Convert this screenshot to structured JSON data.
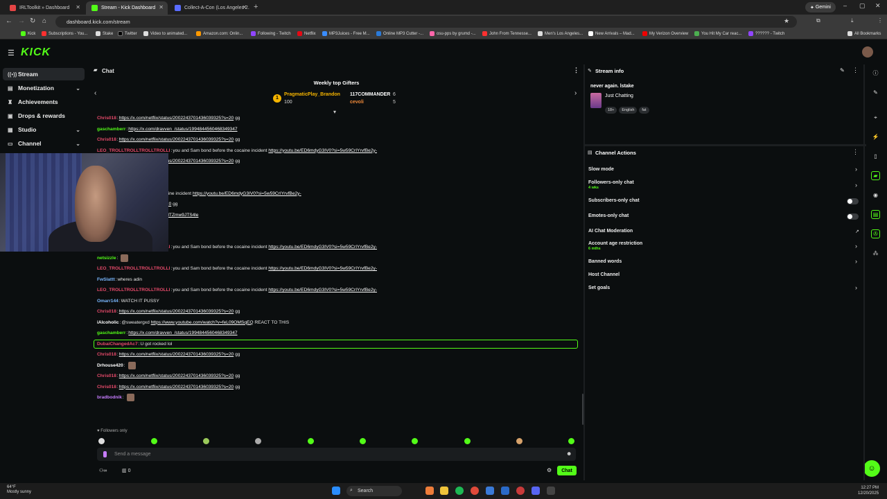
{
  "browser": {
    "tabs": [
      {
        "label": "IRLToolkit » Dashboard",
        "color": "#e54545"
      },
      {
        "label": "Stream - Kick Dashboard",
        "color": "#53fc18"
      },
      {
        "label": "Collect-A-Con (Los Angeles 2.",
        "color": "#5a6cff"
      }
    ],
    "gemini": "Gemini",
    "url": "dashboard.kick.com/stream",
    "bookmarks": [
      "Kick",
      "Subscriptions - You...",
      "Stake",
      "Twitter",
      "Video to animated...",
      "Amazon.com: Onlin...",
      "Following - Twitch",
      "Netflix",
      "MP3Juices - Free M...",
      "Online MP3 Cutter -...",
      "osu-pps by grumd -...",
      "John From Tennesse...",
      "Men's Los Angeles...",
      "New Arrivals – Mad...",
      "My Verizon Overview",
      "You Hit My Car reac...",
      "?????? - Twitch"
    ],
    "all_bookmarks": "All Bookmarks"
  },
  "sidebar": {
    "items": [
      {
        "label": "Stream",
        "icon": "broadcast-icon"
      },
      {
        "label": "Monetization",
        "icon": "money-icon"
      },
      {
        "label": "Achievements",
        "icon": "trophy-icon"
      },
      {
        "label": "Drops & rewards",
        "icon": "gift-icon"
      },
      {
        "label": "Studio",
        "icon": "studio-icon"
      },
      {
        "label": "Channel",
        "icon": "channel-icon"
      }
    ]
  },
  "chat": {
    "title": "Chat",
    "gifters_title": "Weekly top Gifters",
    "gifters": [
      {
        "name": "PragmaticPlay_Brandon",
        "count": "100"
      },
      {
        "name": "117COMMANDER",
        "count": "6"
      },
      {
        "name": "cevoli",
        "count": "5"
      }
    ],
    "messages": [
      {
        "user": "Chris018",
        "color": "#e64a6a",
        "text": "https://x.com/netflix/status/2002243701436039325?s=20 gg"
      },
      {
        "user": "gaschamberr",
        "color": "#53fc18",
        "text": "https://x.com/dravven_/status/1994844560468349347"
      },
      {
        "user": "Chris018",
        "color": "#e64a6a",
        "text": "https://x.com/netflix/status/2002243701436039325?s=20 gg"
      },
      {
        "user": "LEO_TROLLTROLLTROLLTROLLI",
        "color": "#e64a6a",
        "text": "you and Sam bond before the cocaine incident https://youtu.be/ED6mdyG3IV0?si=5w59CrIYrvfBe2y-"
      },
      {
        "user": "Chris018",
        "color": "#e64a6a",
        "text": "https://x.com/netflix/status/2002243701436039325?s=20 gg"
      },
      {
        "user": "",
        "color": "#e64a6a",
        "text": "m/rampagejackson"
      },
      {
        "user": "",
        "color": "#e64a6a",
        "text": "one"
      },
      {
        "user": "",
        "color": "#e64a6a",
        "text": "you and Sam bond before the cocaine incident https://youtu.be/ED6mdyG3IV0?si=5w59CrIYrvfBe2y-"
      },
      {
        "user": "",
        "color": "#e64a6a",
        "text": "status/2002243701436039325?s=20 gg"
      },
      {
        "user": "",
        "color": "#e64a6a",
        "text": "outu.be/u33PXQg43Eo?si=UOmRdTZmw9JTS4le"
      },
      {
        "user": "",
        "color": "#e64a6a",
        "text": "d of you"
      },
      {
        "user": "Drhouse420",
        "color": "#ffffff",
        "text": ""
      },
      {
        "user": "LEO_TROLLTROLLTROLLTROLLI",
        "color": "#e64a6a",
        "text": "you and Sam bond before the cocaine incident https://youtu.be/ED6mdyG3IV0?si=5w59CrIYrvfBe2y-"
      },
      {
        "user": "netsizzle",
        "color": "#53fc18",
        "text": ""
      },
      {
        "user": "LEO_TROLLTROLLTROLLTROLLI",
        "color": "#e64a6a",
        "text": "you and Sam bond before the cocaine incident https://youtu.be/ED6mdyG3IV0?si=5w59CrIYrvfBe2y-"
      },
      {
        "user": "FwSlattt",
        "color": "#7ab8ff",
        "text": "wheres adin"
      },
      {
        "user": "LEO_TROLLTROLLTROLLTROLLI",
        "color": "#e64a6a",
        "text": "you and Sam bond before the cocaine incident https://youtu.be/ED6mdyG3IV0?si=5w59CrIYrvfBe2y-"
      },
      {
        "user": "Omarr144",
        "color": "#7ab8ff",
        "text": "WATCH IT PUSSY"
      },
      {
        "user": "Chris018",
        "color": "#e64a6a",
        "text": "https://x.com/netflix/status/2002243701436039325?s=20 gg"
      },
      {
        "user": "iAlcoholic",
        "color": "#ffffff",
        "text": "@sweatergxd https://www.youtube.com/watch?v=feL09OMSqEQ REACT TO THIS"
      },
      {
        "user": "gaschamberr",
        "color": "#53fc18",
        "text": "https://x.com/dravven_/status/1994844560468349347"
      },
      {
        "user": "DubaiChangedAc7",
        "color": "#e64a6a",
        "text": "U got rocked lol"
      },
      {
        "user": "Chris018",
        "color": "#e64a6a",
        "text": "https://x.com/netflix/status/2002243701436039325?s=20 gg"
      },
      {
        "user": "Drhouse420",
        "color": "#ffffff",
        "text": ""
      },
      {
        "user": "Chris018",
        "color": "#e64a6a",
        "text": "https://x.com/netflix/status/2002243701436039325?s=20 gg"
      },
      {
        "user": "Chris018",
        "color": "#e64a6a",
        "text": "https://x.com/netflix/status/2002243701436039325?s=20 gg"
      },
      {
        "user": "bradbodnik",
        "color": "#c77dff",
        "text": ""
      }
    ],
    "followers_only": "Followers only",
    "input_placeholder": "Send a message",
    "viewers": "0",
    "send_label": "Chat"
  },
  "stream_info": {
    "title": "Stream info",
    "stream_title": "never again. lstake",
    "category": "Just Chatting",
    "tags": [
      "18+",
      "English",
      "fat"
    ]
  },
  "channel_actions": {
    "title": "Channel Actions",
    "items": [
      {
        "label": "Slow mode",
        "sub": "",
        "control": "chevron"
      },
      {
        "label": "Followers-only chat",
        "sub": "4 wks",
        "control": "chevron"
      },
      {
        "label": "Subscribers-only chat",
        "sub": "",
        "control": "toggle"
      },
      {
        "label": "Emotes-only chat",
        "sub": "",
        "control": "toggle"
      },
      {
        "label": "AI Chat Moderation",
        "sub": "",
        "control": "external"
      },
      {
        "label": "Account age restriction",
        "sub": "6 mths",
        "control": "chevron"
      },
      {
        "label": "Banned words",
        "sub": "",
        "control": "chevron"
      },
      {
        "label": "Host Channel",
        "sub": "",
        "control": "none"
      },
      {
        "label": "Set goals",
        "sub": "",
        "control": "chevron"
      }
    ]
  },
  "taskbar": {
    "temp": "64°F",
    "weather": "Mostly sunny",
    "search": "Search",
    "time": "12:27 PM",
    "date": "12/20/2025"
  },
  "colors": {
    "accent": "#53fc18",
    "bg": "#0b0e0f"
  }
}
